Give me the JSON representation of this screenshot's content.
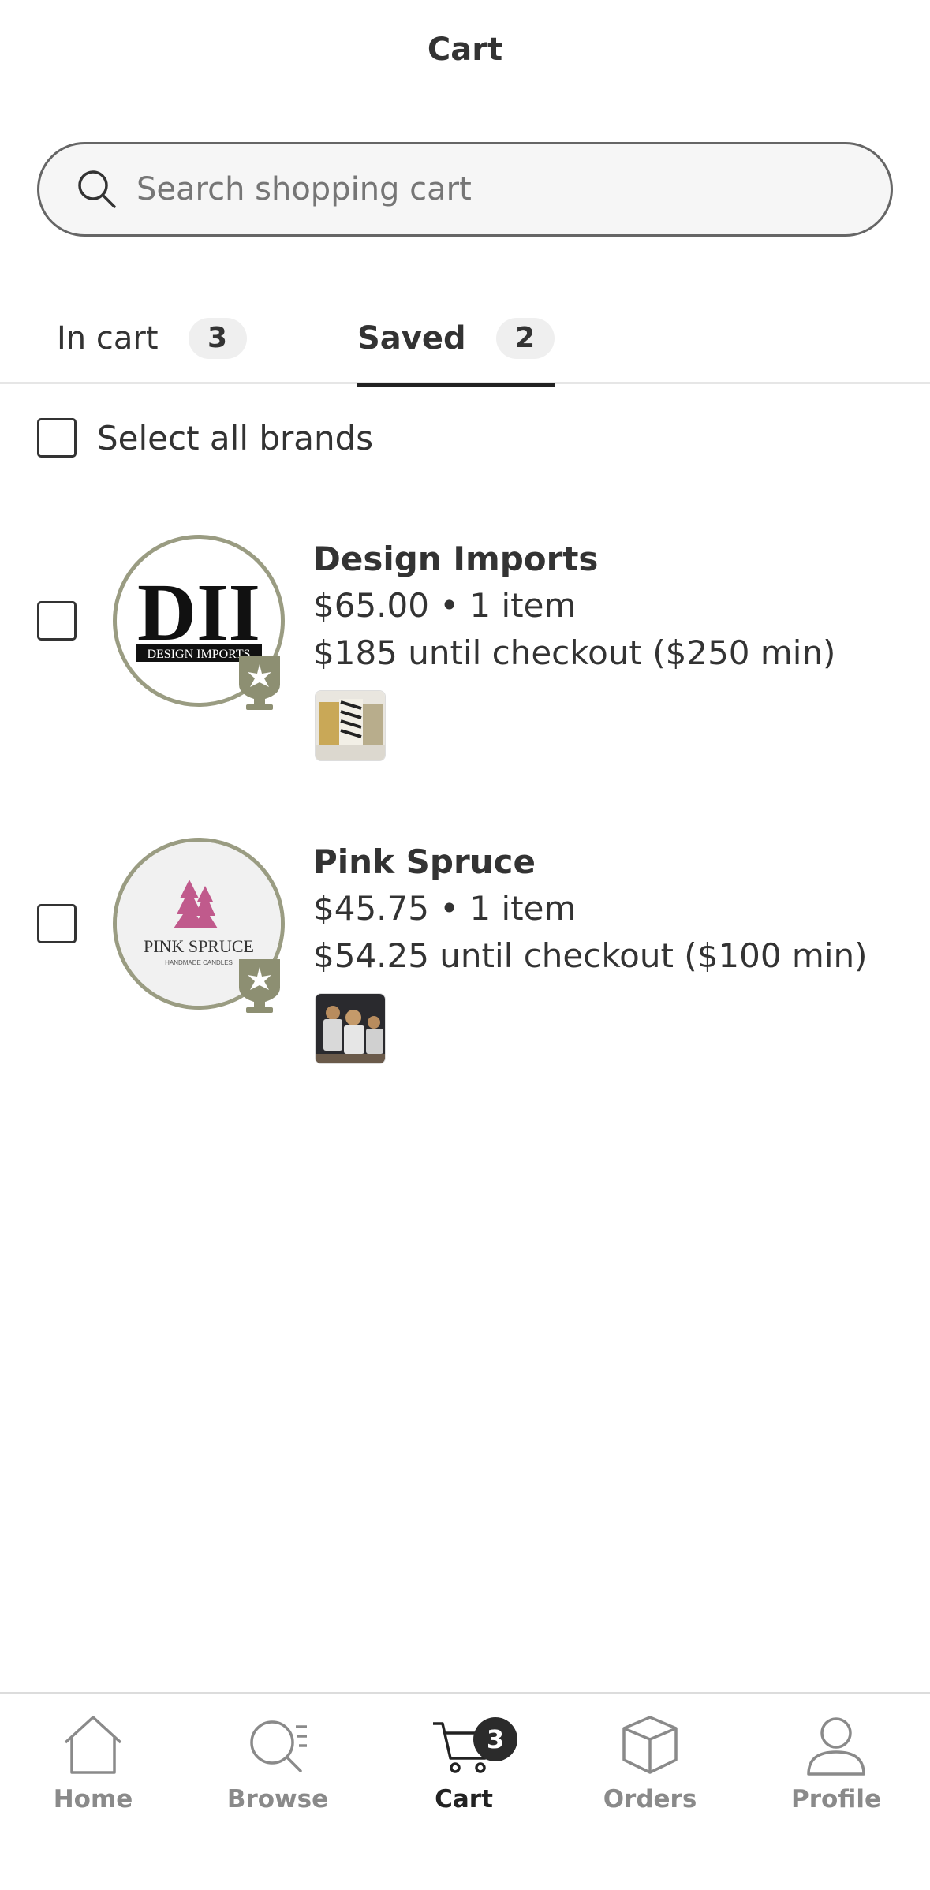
{
  "header": {
    "title": "Cart"
  },
  "search": {
    "placeholder": "Search shopping cart"
  },
  "tabs": [
    {
      "label": "In cart",
      "count": "3",
      "active": false
    },
    {
      "label": "Saved",
      "count": "2",
      "active": true
    }
  ],
  "select_all": {
    "label": "Select all brands"
  },
  "brands": [
    {
      "name": "Design Imports",
      "price_line": "$65.00 • 1 item",
      "checkout_line": "$185 until checkout ($250 min)",
      "logo_text": "DII",
      "logo_subtext": "DESIGN IMPORTS"
    },
    {
      "name": "Pink Spruce",
      "price_line": "$45.75 • 1 item",
      "checkout_line": "$54.25 until checkout ($100 min)",
      "logo_text": "PINK SPRUCE",
      "logo_subtext": "HANDMADE CANDLES"
    }
  ],
  "bottom_nav": {
    "home": "Home",
    "browse": "Browse",
    "cart": "Cart",
    "cart_count": "3",
    "orders": "Orders",
    "profile": "Profile"
  },
  "colors": {
    "logo_ring": "#9a9c82",
    "active_tab_underline": "#222222",
    "pink_tree": "#c05a8c"
  }
}
